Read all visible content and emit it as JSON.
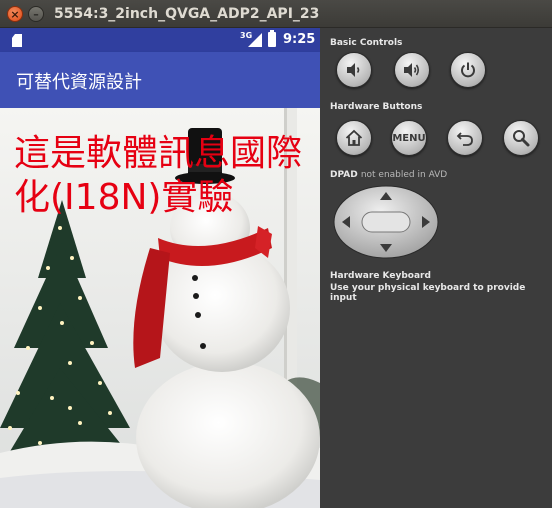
{
  "window": {
    "title": "5554:3_2inch_QVGA_ADP2_API_23",
    "close_glyph": "×",
    "minimize_glyph": "–"
  },
  "status_bar": {
    "network": "3G",
    "time": "9:25",
    "icons": [
      "sd-card-icon",
      "signal-icon",
      "battery-icon"
    ],
    "background": "#303f9f"
  },
  "app_bar": {
    "title": "可替代資源設計",
    "background": "#3f51b5"
  },
  "content": {
    "message": "這是軟體訊息國際化(I18N)實驗",
    "message_color": "#e60012",
    "background_image": "snowman-with-christmas-tree"
  },
  "panel": {
    "basic_controls_label": "Basic Controls",
    "basic_controls": [
      {
        "name": "volume-down-icon"
      },
      {
        "name": "volume-up-icon"
      },
      {
        "name": "power-icon"
      }
    ],
    "hardware_buttons_label": "Hardware Buttons",
    "hardware_buttons": [
      {
        "name": "home-icon"
      },
      {
        "name": "menu-button",
        "label": "MENU"
      },
      {
        "name": "back-icon"
      },
      {
        "name": "search-icon"
      }
    ],
    "dpad_label": "DPAD",
    "dpad_note": "not enabled in AVD",
    "keyboard_label": "Hardware Keyboard",
    "keyboard_note": "Use your physical keyboard to provide input"
  }
}
